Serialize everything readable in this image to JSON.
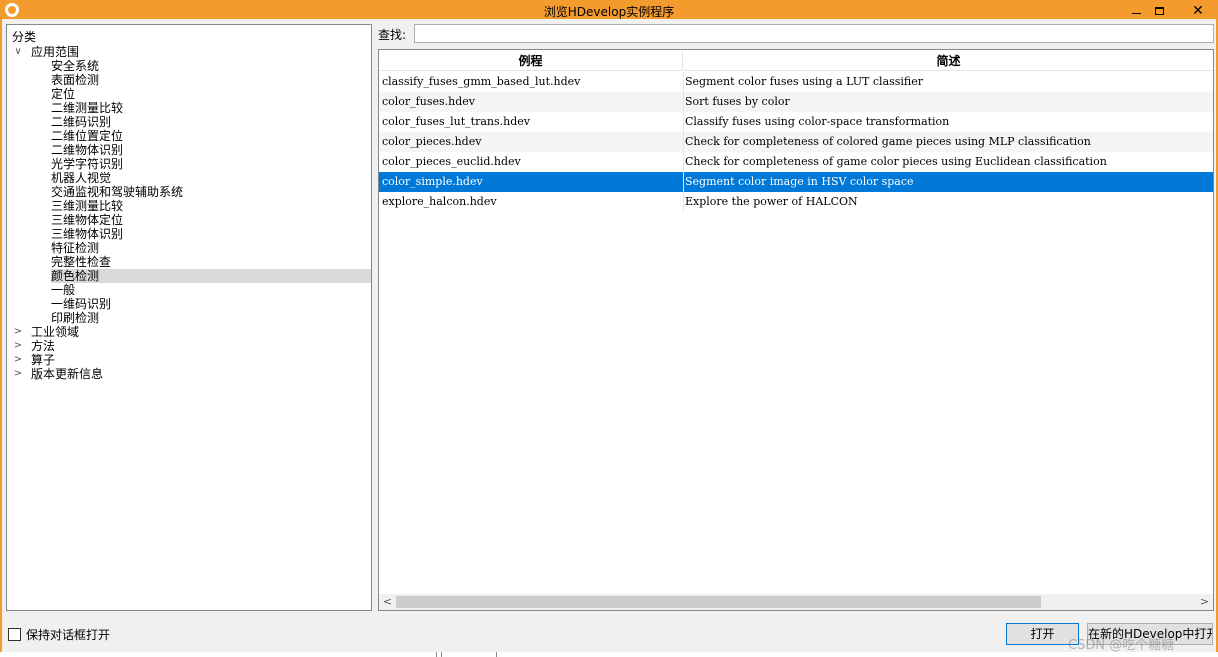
{
  "window": {
    "title": "浏览HDevelop实例程序",
    "minimize_glyph": "",
    "maximize_glyph": "",
    "close_glyph": "✕"
  },
  "tree": {
    "header": "分类",
    "root": {
      "label": "应用范围",
      "expander": "∨",
      "children": [
        "安全系统",
        "表面检测",
        "定位",
        "二维测量比较",
        "二维码识别",
        "二维位置定位",
        "二维物体识别",
        "光学字符识别",
        "机器人视觉",
        "交通监视和驾驶辅助系统",
        "三维测量比较",
        "三维物体定位",
        "三维物体识别",
        "特征检测",
        "完整性检查",
        "颜色检测",
        "一般",
        "一维码识别",
        "印刷检测"
      ],
      "selected_child": "颜色检测"
    },
    "collapsed": [
      {
        "label": "工业领域",
        "expander": ">"
      },
      {
        "label": "方法",
        "expander": ">"
      },
      {
        "label": "算子",
        "expander": ">"
      },
      {
        "label": "版本更新信息",
        "expander": ">"
      }
    ]
  },
  "search": {
    "label": "查找:",
    "value": "",
    "placeholder": ""
  },
  "table": {
    "columns": [
      "例程",
      "简述"
    ],
    "rows": [
      {
        "name": "classify_fuses_gmm_based_lut.hdev",
        "desc": "Segment color fuses using a LUT classifier"
      },
      {
        "name": "color_fuses.hdev",
        "desc": "Sort fuses by color"
      },
      {
        "name": "color_fuses_lut_trans.hdev",
        "desc": "Classify fuses using color-space transformation"
      },
      {
        "name": "color_pieces.hdev",
        "desc": "Check for completeness of colored game pieces using MLP classification"
      },
      {
        "name": "color_pieces_euclid.hdev",
        "desc": "Check for completeness of game color pieces using Euclidean classification"
      },
      {
        "name": "color_simple.hdev",
        "desc": "Segment color image in HSV color space"
      },
      {
        "name": "explore_halcon.hdev",
        "desc": "Explore the power of HALCON"
      }
    ],
    "selected_row": 5
  },
  "scrollbar": {
    "left_arrow": "<",
    "right_arrow": ">"
  },
  "footer": {
    "keep_open_label": "保持对话框打开",
    "keep_open_checked": false,
    "open_button": "打开",
    "open_new_button": "在新的HDevelop中打开"
  },
  "watermark": "CSDN @吃个糖糖",
  "colors": {
    "title_bar": "#f39b2d",
    "selection": "#0078d7",
    "tree_selection": "#d9d9d9"
  }
}
